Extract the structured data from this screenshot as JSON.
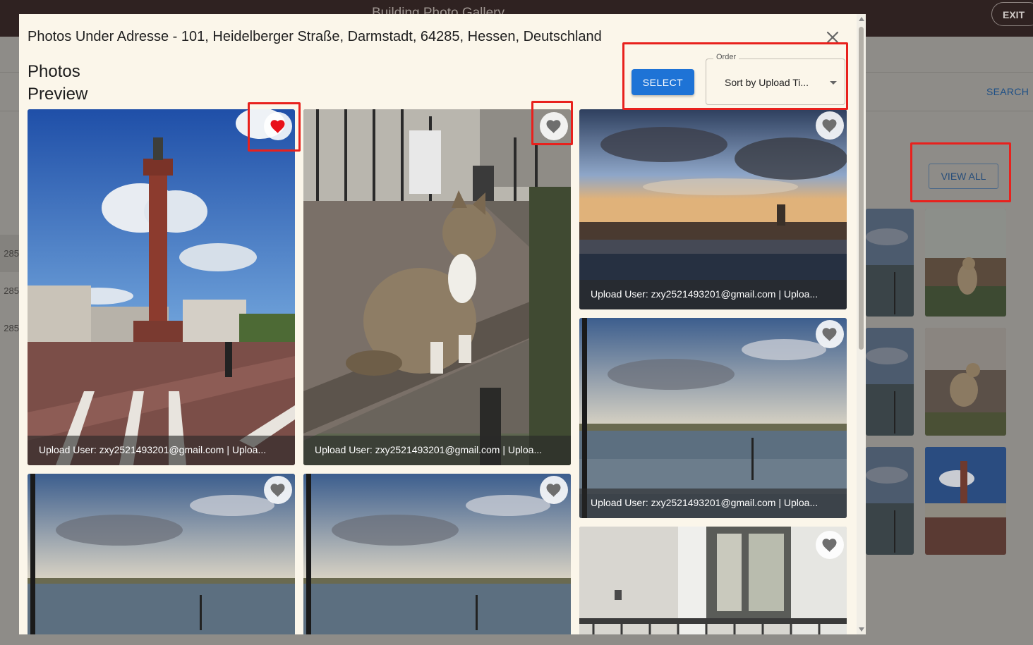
{
  "app": {
    "title": "Building Photo Gallery",
    "exit_label": "EXIT"
  },
  "background": {
    "search_label": "SEARCH",
    "view_all_label": "VIEW ALL",
    "left_labels": [
      "285",
      "285",
      "285"
    ]
  },
  "modal": {
    "title": "Photos Under Adresse - 101, Heidelberger Straße, Darmstadt, 64285, Hessen, Deutschland",
    "preview_title": "Photos Preview",
    "select_label": "SELECT",
    "order_label": "Order",
    "order_value": "Sort by Upload Ti..."
  },
  "photos": [
    {
      "caption": "Upload User: zxy2521493201@gmail.com | Uploa...",
      "favorite": true,
      "subject": "column-monument"
    },
    {
      "caption": "Upload User: zxy2521493201@gmail.com | Uploa...",
      "favorite": false,
      "subject": "cat-on-bench"
    },
    {
      "caption": "Upload User: zxy2521493201@gmail.com | Uploa...",
      "favorite": false,
      "subject": "harbor-sunset"
    },
    {
      "caption": "Upload User: zxy2521493201@gmail.com | Uploa...",
      "favorite": false,
      "subject": "lake-view"
    },
    {
      "caption": "",
      "favorite": false,
      "subject": "lake-view"
    },
    {
      "caption": "",
      "favorite": false,
      "subject": "lake-view"
    },
    {
      "caption": "",
      "favorite": false,
      "subject": "window-shutters"
    }
  ],
  "colors": {
    "favorite_active": "#e8101a",
    "favorite_inactive": "#6e6e6e",
    "select_button": "#1e73d6",
    "highlight": "#e8211d"
  }
}
